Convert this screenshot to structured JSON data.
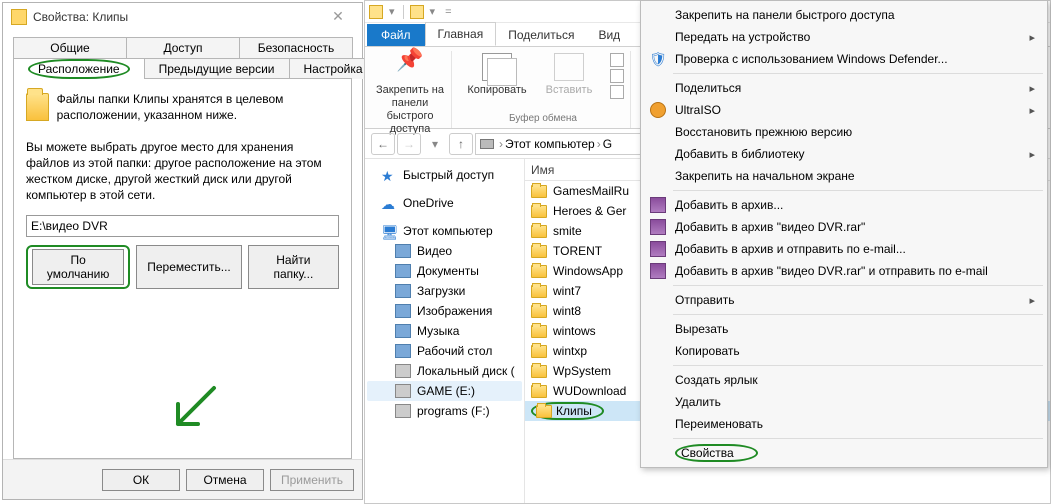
{
  "properties_dialog": {
    "title": "Свойства: Клипы",
    "tabs_row1": [
      "Общие",
      "Доступ",
      "Безопасность"
    ],
    "tabs_row2": [
      "Расположение",
      "Предыдущие версии",
      "Настройка"
    ],
    "active_tab": "Расположение",
    "line1": "Файлы папки Клипы хранятся в целевом расположении, указанном ниже.",
    "line2": "Вы можете выбрать другое место для хранения файлов из этой папки: другое расположение на этом жестком диске, другой жесткий диск или другой компьютер в этой сети.",
    "path_value": "E:\\видео DVR",
    "btn_restore": "По умолчанию",
    "btn_move": "Переместить...",
    "btn_find": "Найти папку...",
    "footer_ok": "ОК",
    "footer_cancel": "Отмена",
    "footer_apply": "Применить"
  },
  "explorer": {
    "ribbon_file": "Файл",
    "ribbon_tabs": [
      "Главная",
      "Поделиться",
      "Вид"
    ],
    "ribbon_active": "Главная",
    "btn_pin": "Закрепить на панели быстрого доступа",
    "btn_copy": "Копировать",
    "btn_paste": "Вставить",
    "group_clipboard": "Буфер обмена",
    "nav_back": "←",
    "nav_fwd": "→",
    "nav_up": "↑",
    "breadcrumb": [
      "Этот компьютер",
      "G"
    ],
    "col_name": "Имя",
    "quick_access": "Быстрый доступ",
    "onedrive": "OneDrive",
    "this_pc": "Этот компьютер",
    "nav_items": [
      "Видео",
      "Документы",
      "Загрузки",
      "Изображения",
      "Музыка",
      "Рабочий стол",
      "Локальный диск (",
      "GAME (E:)",
      "programs (F:)"
    ],
    "files": [
      "GamesMailRu",
      "Heroes & Ger",
      "smite",
      "TORENT",
      "WindowsApp",
      "wint7",
      "wint8",
      "wintows",
      "wintxp",
      "WpSystem",
      "WUDownload",
      "Клипы"
    ],
    "selected_file": "Клипы"
  },
  "context_menu": {
    "items_top": [
      {
        "label": "Закрепить на панели быстрого доступа",
        "icon": null,
        "sub": false
      },
      {
        "label": "Передать на устройство",
        "icon": null,
        "sub": true
      },
      {
        "label": "Проверка с использованием Windows Defender...",
        "icon": "shield",
        "sub": false
      }
    ],
    "items_share": [
      {
        "label": "Поделиться",
        "icon": null,
        "sub": true
      },
      {
        "label": "UltraISO",
        "icon": "ultra",
        "sub": true
      },
      {
        "label": "Восстановить прежнюю версию",
        "icon": null,
        "sub": false
      },
      {
        "label": "Добавить в библиотеку",
        "icon": null,
        "sub": true
      },
      {
        "label": "Закрепить на начальном экране",
        "icon": null,
        "sub": false
      }
    ],
    "items_rar": [
      {
        "label": "Добавить в архив...",
        "icon": "rar",
        "sub": false
      },
      {
        "label": "Добавить в архив \"видео DVR.rar\"",
        "icon": "rar",
        "sub": false
      },
      {
        "label": "Добавить в архив и отправить по e-mail...",
        "icon": "rar",
        "sub": false
      },
      {
        "label": "Добавить в архив \"видео DVR.rar\" и отправить по e-mail",
        "icon": "rar",
        "sub": false
      }
    ],
    "items_send": [
      {
        "label": "Отправить",
        "icon": null,
        "sub": true
      }
    ],
    "items_edit": [
      {
        "label": "Вырезать",
        "icon": null,
        "sub": false
      },
      {
        "label": "Копировать",
        "icon": null,
        "sub": false
      }
    ],
    "items_new": [
      {
        "label": "Создать ярлык",
        "icon": null,
        "sub": false
      },
      {
        "label": "Удалить",
        "icon": null,
        "sub": false
      },
      {
        "label": "Переименовать",
        "icon": null,
        "sub": false
      }
    ],
    "items_props": [
      {
        "label": "Свойства",
        "icon": null,
        "sub": false,
        "highlight": true
      }
    ]
  }
}
